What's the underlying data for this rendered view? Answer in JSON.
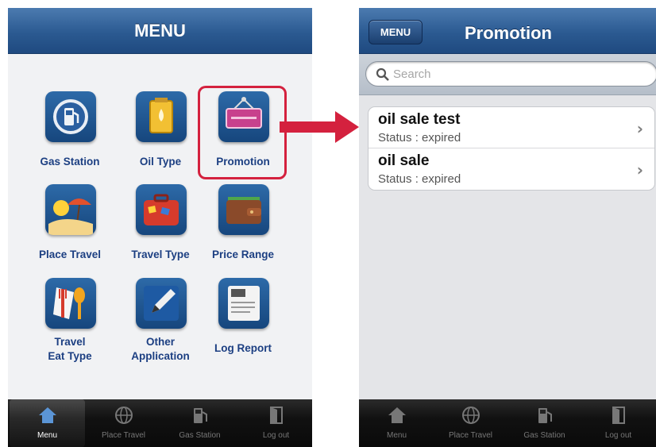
{
  "left_screen": {
    "title": "MENU",
    "menu_items": [
      {
        "label": "Gas Station",
        "icon": "gas-pump-icon"
      },
      {
        "label": "Oil Type",
        "icon": "oil-can-icon"
      },
      {
        "label": "Promotion",
        "icon": "promotion-sign-icon"
      },
      {
        "label": "Place Travel",
        "icon": "beach-umbrella-icon"
      },
      {
        "label": "Travel Type",
        "icon": "suitcase-icon"
      },
      {
        "label": "Price Range",
        "icon": "wallet-icon"
      },
      {
        "label": "Travel",
        "label2": "Eat Type",
        "icon": "fork-spoon-icon"
      },
      {
        "label": "Other",
        "label2": "Application",
        "icon": "pencil-icon"
      },
      {
        "label": "Log Report",
        "icon": "log-document-icon"
      }
    ],
    "tabs": [
      {
        "label": "Menu",
        "icon": "house-icon"
      },
      {
        "label": "Place Travel",
        "icon": "globe-icon"
      },
      {
        "label": "Gas Station",
        "icon": "gas-pump-icon"
      },
      {
        "label": "Log out",
        "icon": "door-icon"
      }
    ]
  },
  "right_screen": {
    "back_button": "MENU",
    "title": "Promotion",
    "search_placeholder": "Search",
    "rows": [
      {
        "title": "oil sale test",
        "status": "Status : expired"
      },
      {
        "title": "oil sale",
        "status": "Status : expired"
      }
    ],
    "tabs": [
      {
        "label": "Menu",
        "icon": "house-icon"
      },
      {
        "label": "Place Travel",
        "icon": "globe-icon"
      },
      {
        "label": "Gas Station",
        "icon": "gas-pump-icon"
      },
      {
        "label": "Log out",
        "icon": "door-icon"
      }
    ]
  },
  "colors": {
    "nav_blue": "#2b5a91",
    "label_blue": "#1c3f82",
    "highlight_red": "#d4213e"
  }
}
